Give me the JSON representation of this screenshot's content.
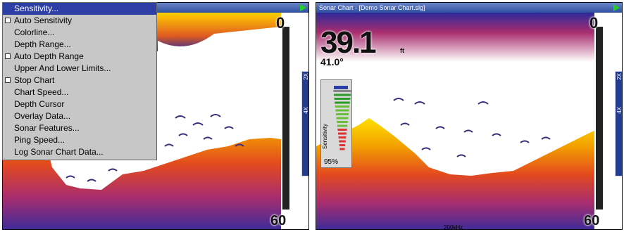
{
  "left_screen": {
    "menu": {
      "items": [
        {
          "label": "Sensitivity...",
          "checkbox": false,
          "selected": true
        },
        {
          "label": "Auto Sensitivity",
          "checkbox": true,
          "selected": false
        },
        {
          "label": "Colorline...",
          "checkbox": false,
          "selected": false
        },
        {
          "label": "Depth Range...",
          "checkbox": false,
          "selected": false
        },
        {
          "label": "Auto Depth Range",
          "checkbox": true,
          "selected": false
        },
        {
          "label": "Upper And Lower Limits...",
          "checkbox": false,
          "selected": false
        },
        {
          "label": "Stop Chart",
          "checkbox": true,
          "selected": false
        },
        {
          "label": "Chart Speed...",
          "checkbox": false,
          "selected": false
        },
        {
          "label": "Depth Cursor",
          "checkbox": false,
          "selected": false
        },
        {
          "label": "Overlay Data...",
          "checkbox": false,
          "selected": false
        },
        {
          "label": "Sonar Features...",
          "checkbox": false,
          "selected": false
        },
        {
          "label": "Ping Speed...",
          "checkbox": false,
          "selected": false
        },
        {
          "label": "Log Sonar Chart Data...",
          "checkbox": false,
          "selected": false
        }
      ]
    },
    "scale_top": "0",
    "scale_bottom": "60",
    "zoom_labels": [
      "2X",
      "4X"
    ]
  },
  "right_screen": {
    "title": "Sonar Chart - [Demo Sonar Chart.slg]",
    "depth_value": "39.1",
    "depth_unit": "ft",
    "temperature": "41.0°",
    "sensitivity_label": "Sensitivity",
    "sensitivity_value": "95%",
    "sensitivity_level": 0.95,
    "frequency": "200kHz",
    "scale_top": "0",
    "scale_bottom": "60",
    "zoom_labels": [
      "2X",
      "4X"
    ]
  },
  "colors": {
    "title_bar": "#3a58a8",
    "menu_bg": "#c7c7c7",
    "menu_selected": "#2d3fa5",
    "bottom_hot": "#ffd200",
    "bottom_mid": "#e04020",
    "bottom_deep": "#2b2a9a",
    "go_arrow": "#22d022"
  }
}
